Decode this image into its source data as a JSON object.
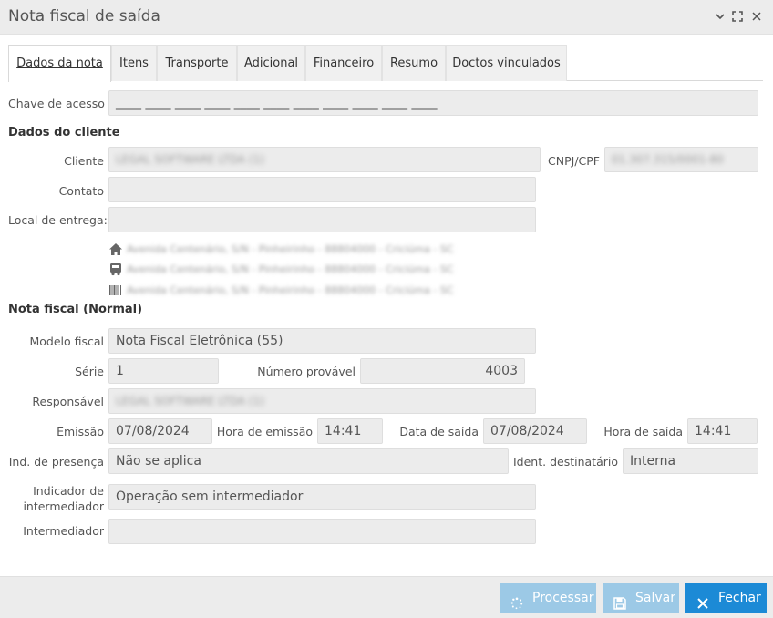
{
  "window": {
    "title": "Nota fiscal de saída",
    "minimize_glyph": "⌄",
    "maximize_glyph": "⛶",
    "close_glyph": "✕"
  },
  "tabs": [
    {
      "label": "Dados da nota",
      "active": true
    },
    {
      "label": "Itens"
    },
    {
      "label": "Transporte"
    },
    {
      "label": "Adicional"
    },
    {
      "label": "Financeiro"
    },
    {
      "label": "Resumo"
    },
    {
      "label": "Doctos vinculados"
    }
  ],
  "chave": {
    "label": "Chave de acesso",
    "value": "____ ____ ____ ____ ____ ____ ____ ____ ____ ____ ____"
  },
  "cliente_section": {
    "title": "Dados do cliente",
    "cliente_label": "Cliente",
    "cliente_value": "LEGAL SOFTWARE LTDA (1)",
    "cnpj_label": "CNPJ/CPF",
    "cnpj_value": "01.307.315/0001-80",
    "contato_label": "Contato",
    "contato_value": "",
    "local_label": "Local de entrega:",
    "local_value": "",
    "addresses": [
      {
        "icon": "home-icon",
        "text": "Avenida Centenário, S/N - Pinheirinho - 88804000 - Criciúma - SC"
      },
      {
        "icon": "truck-icon",
        "text": "Avenida Centenário, S/N - Pinheirinho - 88804000 - Criciúma - SC"
      },
      {
        "icon": "barcode-icon",
        "text": "Avenida Centenário, S/N - Pinheirinho - 88804000 - Criciúma - SC"
      }
    ]
  },
  "nota_section": {
    "title": "Nota fiscal (Normal)",
    "modelo_label": "Modelo fiscal",
    "modelo_value": "Nota Fiscal Eletrônica (55)",
    "serie_label": "Série",
    "serie_value": "1",
    "numero_label": "Número provável",
    "numero_value": "4003",
    "responsavel_label": "Responsável",
    "responsavel_value": "LEGAL SOFTWARE LTDA (1)",
    "emissao_label": "Emissão",
    "emissao_value": "07/08/2024",
    "hora_emissao_label": "Hora de emissão",
    "hora_emissao_value": "14:41",
    "data_saida_label": "Data de saída",
    "data_saida_value": "07/08/2024",
    "hora_saida_label": "Hora de saída",
    "hora_saida_value": "14:41",
    "presenca_label": "Ind. de presença",
    "presenca_value": "Não se aplica",
    "destinatario_label": "Ident. destinatário",
    "destinatario_value": "Interna",
    "indicador_label_1": "Indicador de",
    "indicador_label_2": "intermediador",
    "indicador_value": "Operação sem intermediador",
    "intermediador_label": "Intermediador",
    "intermediador_value": ""
  },
  "footer": {
    "processar_label": "Processar",
    "salvar_label": "Salvar",
    "fechar_label": "Fechar"
  },
  "colors": {
    "primary": "#1c8ad6",
    "disabled": "#9cc9e6",
    "field_bg": "#ececec",
    "titlebar_bg": "#ececec"
  }
}
